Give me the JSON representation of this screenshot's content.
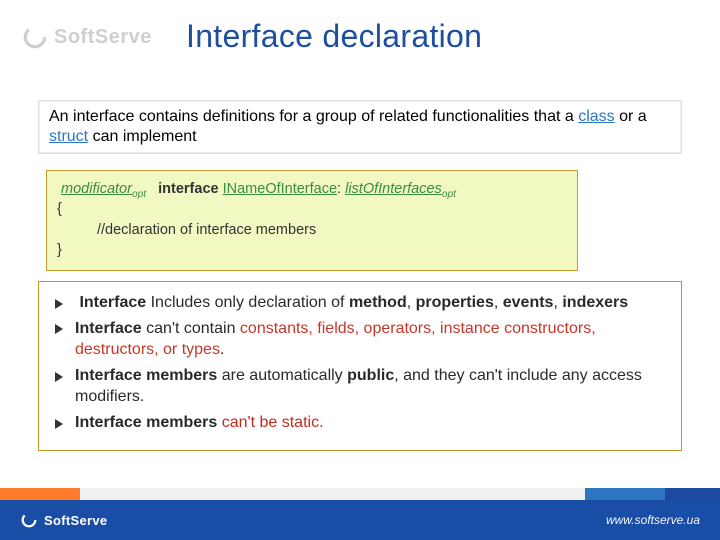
{
  "header": {
    "brand_top": "SoftServe",
    "title": "Interface declaration"
  },
  "definition": {
    "pre": "An interface contains definitions for a group of related functionalities that a ",
    "link_class": "class",
    "mid": " or a ",
    "link_struct": "struct",
    "suf": " can implement"
  },
  "syntax": {
    "modificator": "modificator",
    "opt": "opt",
    "keyword": "interface",
    "iname": "INameOfInterface",
    "colon": ":",
    "loi": "listOfInterfaces",
    "brace_open": "{",
    "comment": "//declaration of interface members",
    "brace_close": "}"
  },
  "rules": [
    {
      "a": "Interface ",
      "b": "Includes only declaration of  ",
      "c": "method",
      "d": ",  ",
      "e": "properties",
      "f": ",  ",
      "g": "events",
      "h": ", ",
      "i": "indexers"
    },
    {
      "a": "Interface ",
      "b": "can't contain ",
      "c": "constants, fields, operators, instance constructors, destructors, or types",
      "d": "."
    },
    {
      "a": "Interface members ",
      "b": "are automatically ",
      "c": "public",
      "d": ", and they can't include any access modifiers."
    },
    {
      "a": "Interface members ",
      "b": "",
      "c": "can't be static."
    }
  ],
  "footer": {
    "brand": "SoftServe",
    "url": "www.softserve.ua"
  }
}
